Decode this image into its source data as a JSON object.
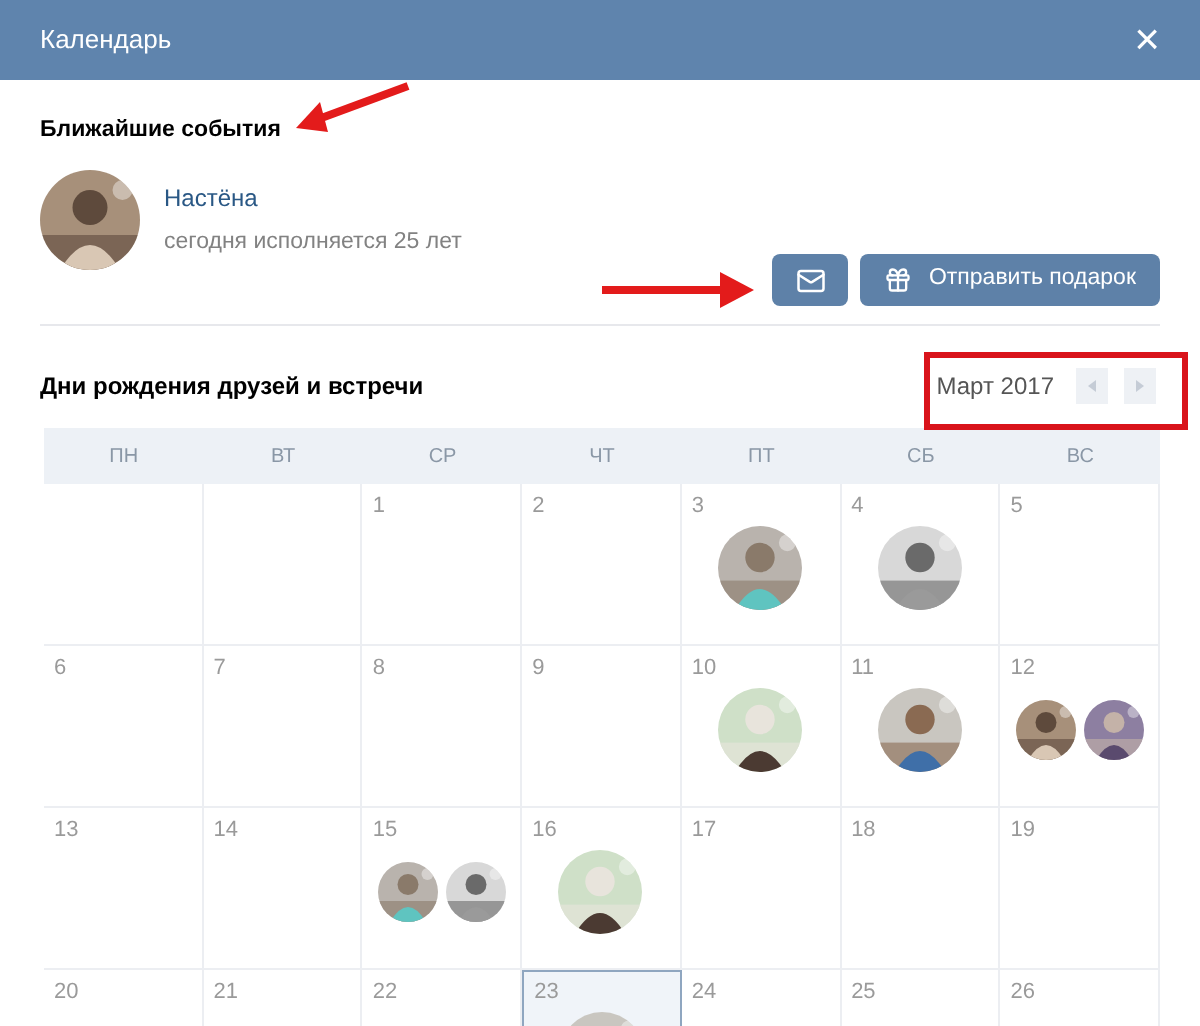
{
  "window": {
    "title": "Календарь",
    "close": "×"
  },
  "upcoming": {
    "title": "Ближайшие события",
    "person": {
      "name": "Настёна",
      "note": "сегодня исполняется 25 лет"
    },
    "gift_button": "Отправить подарок"
  },
  "calendar": {
    "title": "Дни рождения друзей и встречи",
    "month": "Март 2017",
    "weekdays": [
      "ПН",
      "ВТ",
      "СР",
      "ЧТ",
      "ПТ",
      "СБ",
      "ВС"
    ],
    "weeks": [
      [
        {
          "selected": false
        },
        {
          "selected": false
        },
        {
          "day": "1",
          "selected": false
        },
        {
          "day": "2",
          "selected": false
        },
        {
          "day": "3",
          "selected": false
        },
        {
          "day": "4",
          "selected": false
        },
        {
          "day": "5",
          "selected": false
        }
      ],
      [
        {
          "day": "6",
          "selected": false
        },
        {
          "day": "7",
          "selected": false
        },
        {
          "day": "8",
          "selected": false
        },
        {
          "day": "9",
          "selected": false
        },
        {
          "day": "10",
          "selected": false
        },
        {
          "day": "11",
          "selected": false
        },
        {
          "day": "12",
          "selected": false
        }
      ],
      [
        {
          "day": "13",
          "selected": false
        },
        {
          "day": "14",
          "selected": false
        },
        {
          "day": "15",
          "selected": false
        },
        {
          "day": "16",
          "selected": false
        },
        {
          "day": "17",
          "selected": false
        },
        {
          "day": "18",
          "selected": false
        },
        {
          "day": "19",
          "selected": false
        }
      ],
      [
        {
          "day": "20",
          "selected": false
        },
        {
          "day": "21",
          "selected": false
        },
        {
          "day": "22",
          "selected": false
        },
        {
          "day": "23",
          "selected": true
        },
        {
          "day": "24",
          "selected": false
        },
        {
          "day": "25",
          "selected": false
        },
        {
          "day": "26",
          "selected": false
        }
      ]
    ]
  },
  "annotations": [
    {
      "kind": "arrow-left"
    },
    {
      "kind": "arrow-right"
    },
    {
      "kind": "frame"
    }
  ]
}
